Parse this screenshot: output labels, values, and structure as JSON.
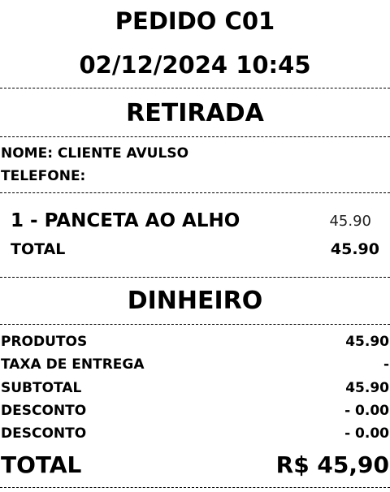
{
  "header": {
    "order_title": "PEDIDO C01",
    "order_datetime": "02/12/2024 10:45"
  },
  "delivery": {
    "type": "RETIRADA"
  },
  "customer": {
    "name_line": "NOME: CLIENTE AVULSO",
    "phone_line": "TELEFONE:"
  },
  "items": [
    {
      "description": "1 - PANCETA AO ALHO",
      "price": "45.90"
    }
  ],
  "items_total": {
    "label": "TOTAL",
    "value": "45.90"
  },
  "payment": {
    "method": "DINHEIRO"
  },
  "summary": [
    {
      "label": "PRODUTOS",
      "value": "45.90"
    },
    {
      "label": "TAXA DE ENTREGA",
      "value": "-"
    },
    {
      "label": "SUBTOTAL",
      "value": "45.90"
    },
    {
      "label": "DESCONTO",
      "value": "- 0.00"
    },
    {
      "label": "DESCONTO",
      "value": "- 0.00"
    }
  ],
  "grand_total": {
    "label": "TOTAL",
    "value": "R$ 45,90"
  }
}
